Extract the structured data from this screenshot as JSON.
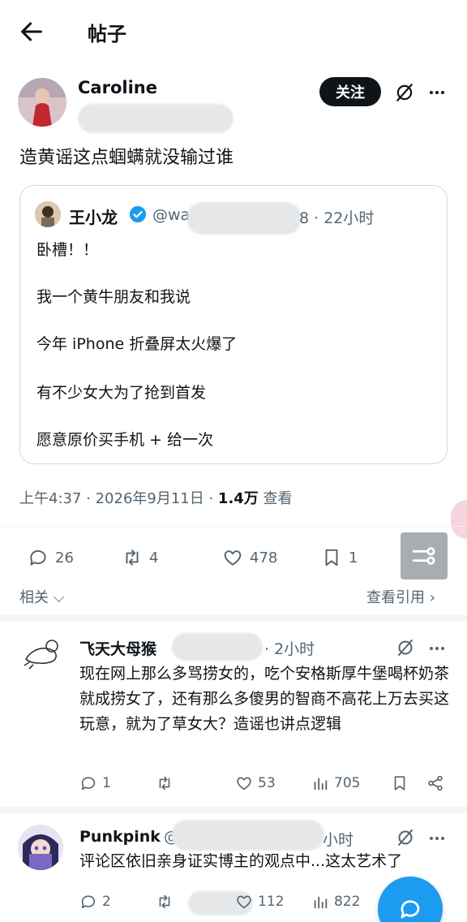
{
  "header": {
    "title": "帖子"
  },
  "post": {
    "author_name": "Caroline",
    "follow_label": "关注",
    "text": "造黄谣这点蝈螨就没输过谁",
    "quote": {
      "name": "王小龙",
      "handle": "@wa",
      "time": "8 · 22小时",
      "lines": [
        "卧槽！！",
        "我一个黄牛朋友和我说",
        "今年 iPhone 折叠屏太火爆了",
        "有不少女大为了抢到首发",
        "愿意原价买手机 + 给一次"
      ]
    },
    "meta": {
      "time": "上午4:37 · 2026年9月11日 · ",
      "views": "1.4万",
      "views_label": " 查看"
    },
    "actions": {
      "replies": "26",
      "reposts": "4",
      "likes": "478",
      "bookmarks": "1"
    },
    "related_label": "相关",
    "quotes_label": "查看引用"
  },
  "replies": [
    {
      "name": "飞天大母猴",
      "time": "· 2小时",
      "text": "现在网上那么多骂捞女的，吃个安格斯厚牛堡喝杯奶茶就成捞女了，还有那么多傻男的智商不高花上万去买这玩意，就为了草女大？造谣也讲点逻辑",
      "replies": "1",
      "likes": "53",
      "views": "705"
    },
    {
      "name": "Punkpink",
      "handle": "@",
      "time": "小时",
      "text": "评论区依旧亲身证实博主的观点中...这太艺术了",
      "replies": "2",
      "likes": "112",
      "views": "822"
    }
  ],
  "colors": {
    "accent": "#1d9bf0",
    "text": "#0f1419",
    "muted": "#536471",
    "border": "#cfd9de"
  }
}
